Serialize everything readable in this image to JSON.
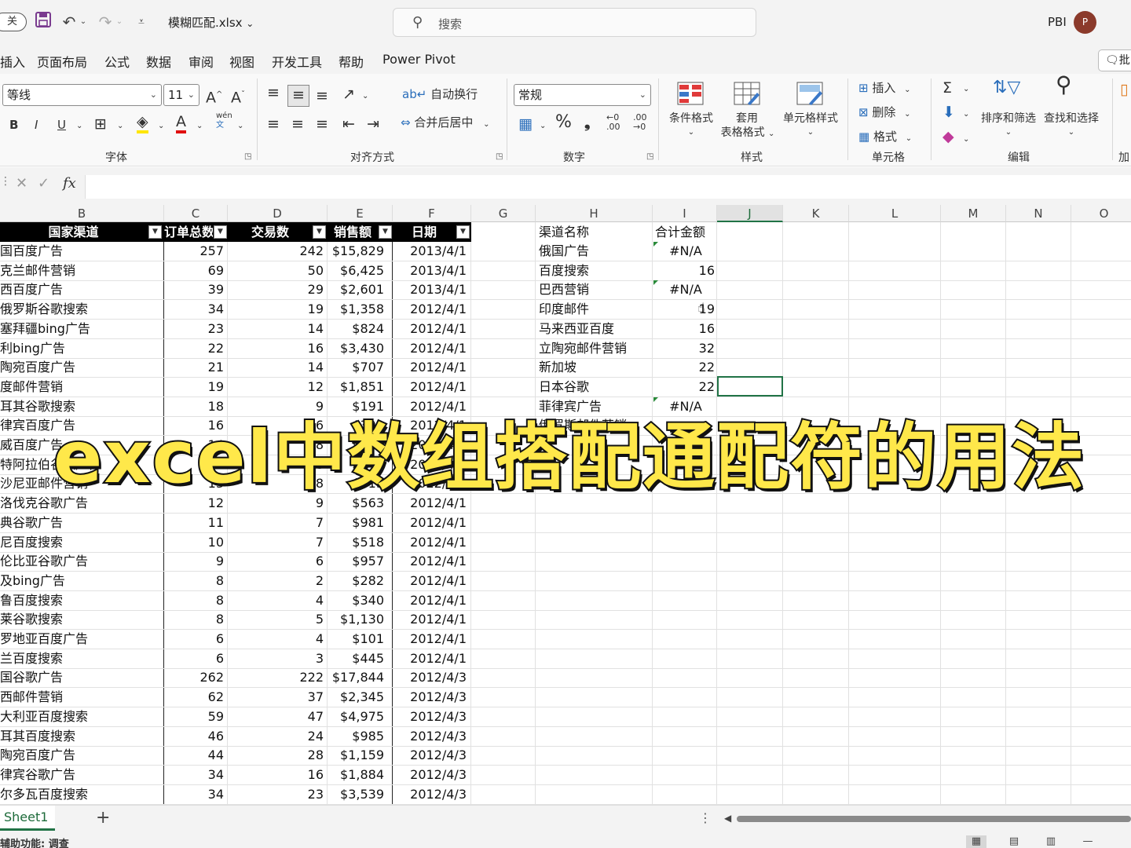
{
  "titlebar": {
    "autosave_label": "关",
    "filename": "模糊匹配.xlsx",
    "search_placeholder": "搜索",
    "account": "PBI",
    "avatar_initial": "P"
  },
  "menu": [
    "插入",
    "页面布局",
    "公式",
    "数据",
    "审阅",
    "视图",
    "开发工具",
    "帮助",
    "Power Pivot"
  ],
  "share_label": "批",
  "ribbon": {
    "font_name": "等线",
    "font_size": "11",
    "wrap_text": "自动换行",
    "merge_center": "合并后居中",
    "number_format": "常规",
    "font_group": "字体",
    "align_group": "对齐方式",
    "number_group": "数字",
    "styles_group": "样式",
    "cells_group": "单元格",
    "edit_group": "编辑",
    "addin_group": "加",
    "conditional_format": "条件格式",
    "table_format_1": "套用",
    "table_format_2": "表格格式",
    "cell_styles": "单元格样式",
    "insert": "插入",
    "delete": "删除",
    "format": "格式",
    "sort_filter": "排序和筛选",
    "find_select": "查找和选择",
    "phonetic": "wén"
  },
  "columns": [
    "B",
    "C",
    "D",
    "E",
    "F",
    "G",
    "H",
    "I",
    "J",
    "K",
    "L",
    "M",
    "N",
    "O"
  ],
  "table": {
    "headers": [
      "国家渠道",
      "订单总数",
      "交易数",
      "销售额",
      "日期"
    ],
    "rows": [
      [
        "国百度广告",
        "257",
        "242",
        "$15,829",
        "2013/4/1"
      ],
      [
        "克兰邮件营销",
        "69",
        "50",
        "$6,425",
        "2013/4/1"
      ],
      [
        "西百度广告",
        "39",
        "29",
        "$2,601",
        "2013/4/1"
      ],
      [
        "俄罗斯谷歌搜索",
        "34",
        "19",
        "$1,358",
        "2012/4/1"
      ],
      [
        "塞拜疆bing广告",
        "23",
        "14",
        "$824",
        "2012/4/1"
      ],
      [
        "利bing广告",
        "22",
        "16",
        "$3,430",
        "2012/4/1"
      ],
      [
        "陶宛百度广告",
        "21",
        "14",
        "$707",
        "2012/4/1"
      ],
      [
        "度邮件营销",
        "19",
        "12",
        "$1,851",
        "2012/4/1"
      ],
      [
        "耳其谷歌搜索",
        "18",
        "9",
        "$191",
        "2012/4/1"
      ],
      [
        "律宾百度广告",
        "16",
        "6",
        "$399",
        "2012/4/1"
      ],
      [
        "威百度广告",
        "14",
        "8",
        "$181",
        "2012/4/1"
      ],
      [
        "特阿拉伯谷歌广告",
        "14",
        "8",
        "$445",
        "2012/4/1"
      ],
      [
        "沙尼亚邮件营销",
        "13",
        "8",
        "$413",
        "2012/4/1"
      ],
      [
        "洛伐克谷歌广告",
        "12",
        "9",
        "$563",
        "2012/4/1"
      ],
      [
        "典谷歌广告",
        "11",
        "7",
        "$981",
        "2012/4/1"
      ],
      [
        "尼百度搜索",
        "10",
        "7",
        "$518",
        "2012/4/1"
      ],
      [
        "伦比亚谷歌广告",
        "9",
        "6",
        "$957",
        "2012/4/1"
      ],
      [
        "及bing广告",
        "8",
        "2",
        "$282",
        "2012/4/1"
      ],
      [
        "鲁百度搜索",
        "8",
        "4",
        "$340",
        "2012/4/1"
      ],
      [
        "莱谷歌搜索",
        "8",
        "5",
        "$1,130",
        "2012/4/1"
      ],
      [
        "罗地亚百度广告",
        "6",
        "4",
        "$101",
        "2012/4/1"
      ],
      [
        "兰百度搜索",
        "6",
        "3",
        "$445",
        "2012/4/1"
      ],
      [
        "国谷歌广告",
        "262",
        "222",
        "$17,844",
        "2012/4/3"
      ],
      [
        "西邮件营销",
        "62",
        "37",
        "$2,345",
        "2012/4/3"
      ],
      [
        "大利亚百度搜索",
        "59",
        "47",
        "$4,975",
        "2012/4/3"
      ],
      [
        "耳其百度搜索",
        "46",
        "24",
        "$985",
        "2012/4/3"
      ],
      [
        "陶宛百度广告",
        "44",
        "28",
        "$1,159",
        "2012/4/3"
      ],
      [
        "律宾谷歌广告",
        "34",
        "16",
        "$1,884",
        "2012/4/3"
      ],
      [
        "尔多瓦百度搜索",
        "34",
        "23",
        "$3,539",
        "2012/4/3"
      ]
    ]
  },
  "lookup": {
    "headers": [
      "渠道名称",
      "合计金额"
    ],
    "rows": [
      [
        "俄国广告",
        "#N/A"
      ],
      [
        "百度搜索",
        "16"
      ],
      [
        "巴西营销",
        "#N/A"
      ],
      [
        "印度邮件",
        "19"
      ],
      [
        "马来西亚百度",
        "16"
      ],
      [
        "立陶宛邮件营销",
        "32"
      ],
      [
        "新加坡",
        "22"
      ],
      [
        "日本谷歌",
        "22"
      ],
      [
        "菲律宾广告",
        "#N/A"
      ],
      [
        "俄罗斯邮件营销",
        ""
      ]
    ]
  },
  "overlay_title": "excel中数组搭配通配符的用法",
  "sheet_tab": "Sheet1",
  "status": "辅助功能: 调查"
}
